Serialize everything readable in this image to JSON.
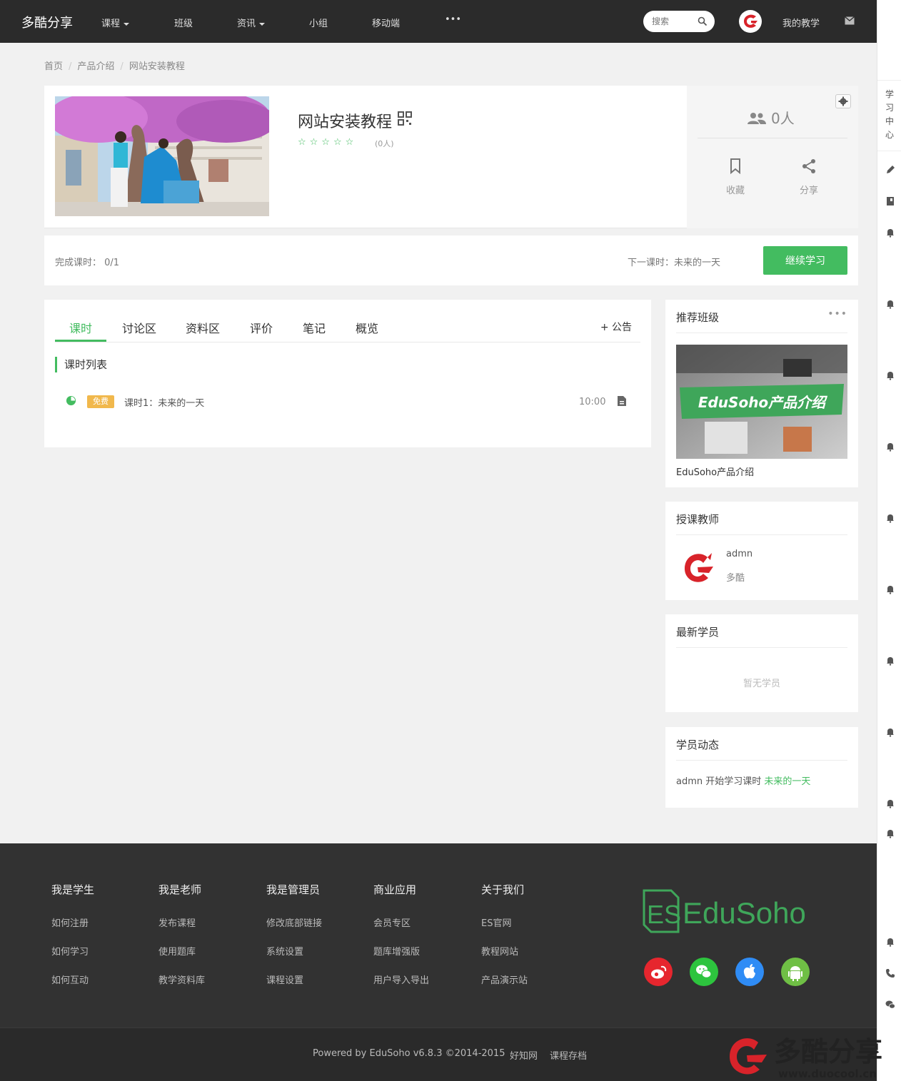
{
  "nav": {
    "brand": "多酷分享",
    "items": [
      "课程",
      "班级",
      "资讯",
      "小组",
      "移动端"
    ],
    "more": "•••",
    "search_placeholder": "搜索",
    "my_teaching": "我的教学"
  },
  "sidebar": {
    "study_center": "学习中心"
  },
  "breadcrumb": [
    "首页",
    "产品介绍",
    "网站安装教程"
  ],
  "course": {
    "title": "网站安装教程",
    "stars": "☆☆☆☆☆",
    "rating_count": "(0人)",
    "students": "0人",
    "favorite": "收藏",
    "share": "分享",
    "progress_label": "完成课时： 0/1",
    "next_lesson": "下一课时：未来的一天",
    "continue_button": "继续学习"
  },
  "tabs": [
    "课时",
    "讨论区",
    "资料区",
    "评价",
    "笔记",
    "概览"
  ],
  "announce": "+ 公告",
  "lesson_list": {
    "title": "课时列表",
    "lessons": [
      {
        "badge": "免费",
        "name": "课时1：未来的一天",
        "duration": "10:00"
      }
    ]
  },
  "recommend_class": {
    "title": "推荐班级",
    "more": "•••",
    "banner_text": "EduSoho产品介绍",
    "class_name": "EduSoho产品介绍"
  },
  "teacher": {
    "title": "授课教师",
    "name": "admn",
    "role": "多酷"
  },
  "new_students": {
    "title": "最新学员",
    "empty": "暂无学员"
  },
  "student_activity": {
    "title": "学员动态",
    "user": "admn",
    "action": " 开始学习课时 ",
    "target": "未来的一天"
  },
  "footer": {
    "columns": [
      {
        "head": "我是学生",
        "links": [
          "如何注册",
          "如何学习",
          "如何互动"
        ]
      },
      {
        "head": "我是老师",
        "links": [
          "发布课程",
          "使用题库",
          "教学资料库"
        ]
      },
      {
        "head": "我是管理员",
        "links": [
          "修改底部链接",
          "系统设置",
          "课程设置"
        ]
      },
      {
        "head": "商业应用",
        "links": [
          "会员专区",
          "题库增强版",
          "用户导入导出"
        ]
      },
      {
        "head": "关于我们",
        "links": [
          "ES官网",
          "教程网站",
          "产品演示站"
        ]
      }
    ],
    "logo_text": "EduSoho",
    "logo_mark": "ES",
    "copyright": "Powered by EduSoho v6.8.3 ©2014-2015",
    "link1": "好知网",
    "link2": "课程存档"
  },
  "watermark": {
    "text": "多酷分享",
    "url": "www.duocool.cn"
  },
  "colors": {
    "accent": "#43bc60",
    "nav_bg": "#2b2b2b",
    "footer_bg": "#323232",
    "badge": "#f1b84c"
  }
}
